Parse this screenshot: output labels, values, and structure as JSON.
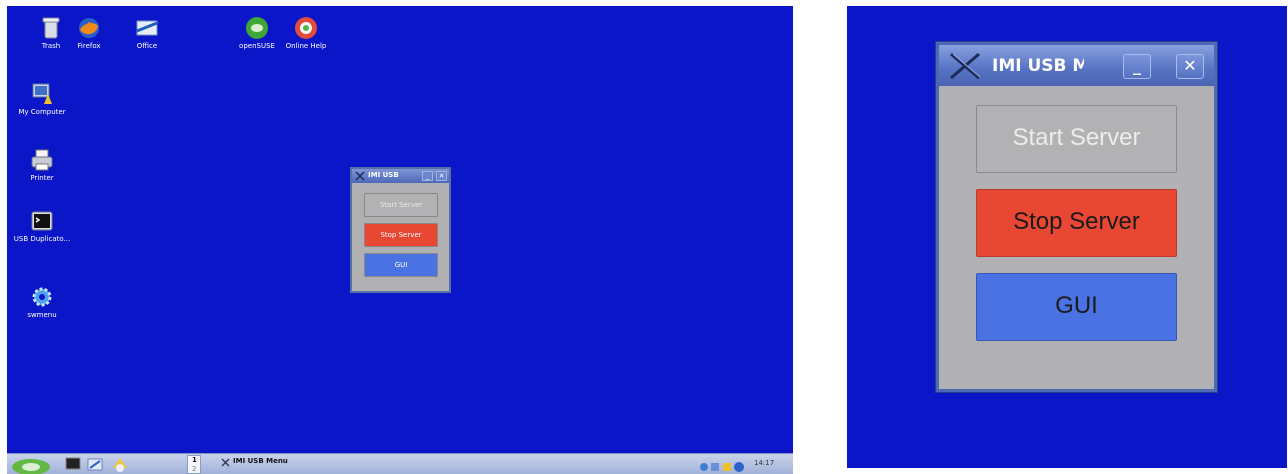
{
  "desktop": {
    "icons": [
      {
        "label": "Trash",
        "icon": "trash-icon"
      },
      {
        "label": "Firefox",
        "icon": "firefox-icon"
      },
      {
        "label": "Office",
        "icon": "office-icon"
      },
      {
        "label": "openSUSE",
        "icon": "opensuse-icon"
      },
      {
        "label": "Online Help",
        "icon": "help-icon"
      },
      {
        "label": "My Computer",
        "icon": "computer-icon"
      },
      {
        "label": "Printer",
        "icon": "printer-icon"
      },
      {
        "label": "USB Duplicato...",
        "icon": "terminal-icon"
      },
      {
        "label": "swmenu",
        "icon": "gear-icon"
      }
    ]
  },
  "window": {
    "title": "IMI USB M",
    "title_small": "IMI USB",
    "minimize": "_",
    "close": "✕",
    "buttons": {
      "start": "Start Server",
      "stop": "Stop Server",
      "gui": "GUI"
    }
  },
  "taskbar": {
    "workspace_1": "1",
    "workspace_2": "2",
    "task_label": "IMI USB Menu",
    "clock": "14:17"
  },
  "colors": {
    "desktop": "#0a16c8",
    "start_button": "#b2b1b4",
    "stop_button": "#e84733",
    "gui_button": "#4a72e3",
    "window_border": "#4d68b4"
  }
}
